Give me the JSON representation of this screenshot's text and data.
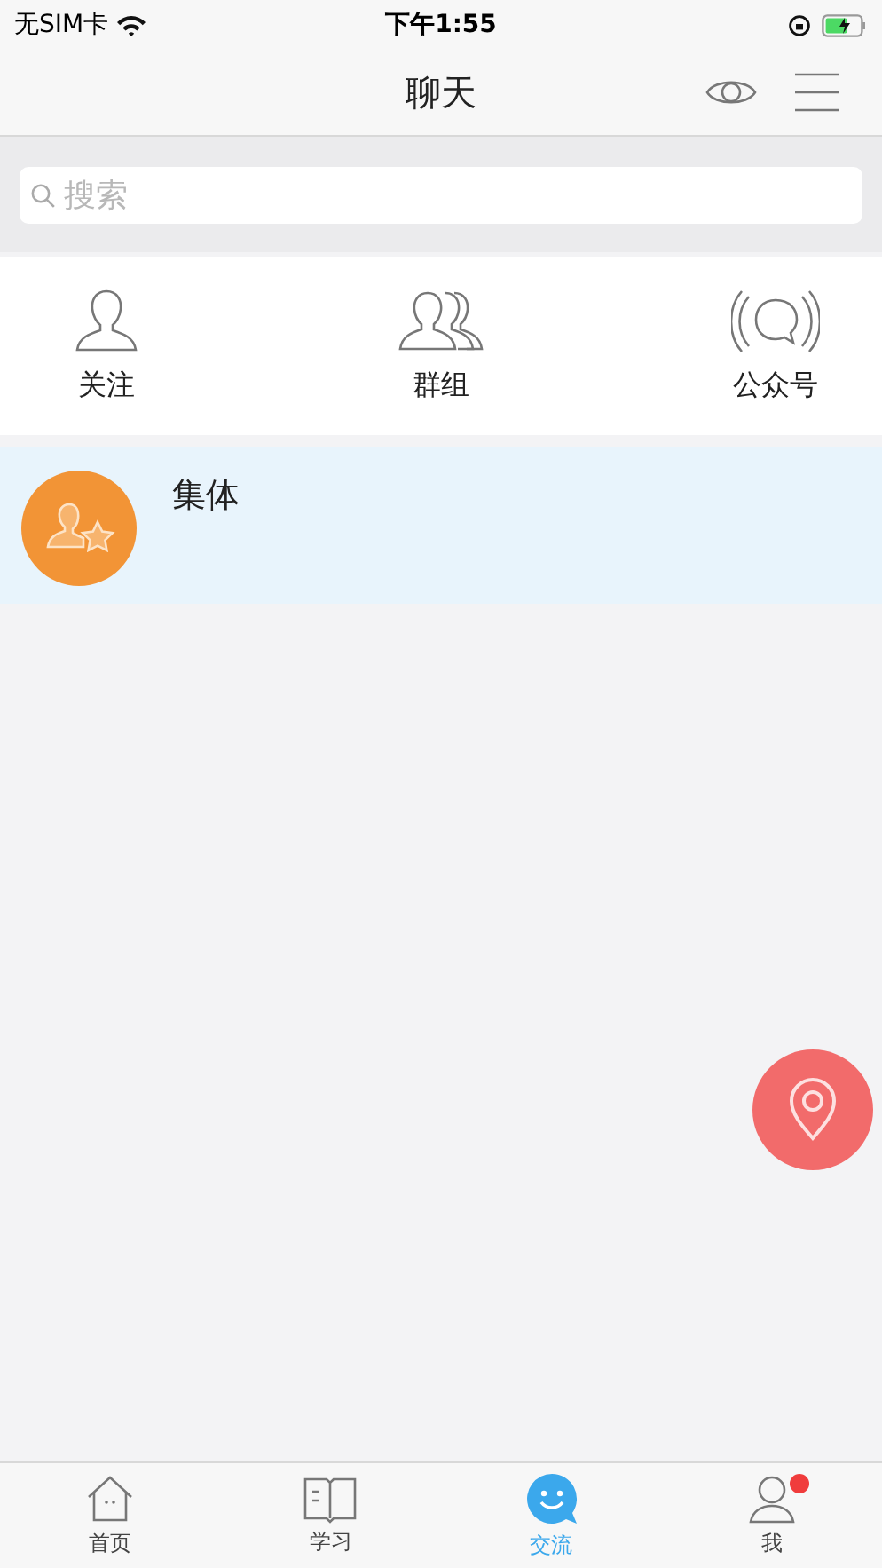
{
  "status_bar": {
    "carrier": "无SIM卡",
    "time": "下午1:55"
  },
  "nav": {
    "title": "聊天"
  },
  "search": {
    "placeholder": "搜索"
  },
  "shortcuts": [
    {
      "kind": "person",
      "label": "关注"
    },
    {
      "kind": "group",
      "label": "群组"
    },
    {
      "kind": "broadcast",
      "label": "公众号"
    }
  ],
  "conversations": [
    {
      "name": "集体",
      "selected": true
    }
  ],
  "tabs": [
    {
      "kind": "home",
      "label": "首页",
      "selected": false,
      "badge": false
    },
    {
      "kind": "book",
      "label": "学习",
      "selected": false,
      "badge": false
    },
    {
      "kind": "chat",
      "label": "交流",
      "selected": true,
      "badge": false
    },
    {
      "kind": "me",
      "label": "我",
      "selected": false,
      "badge": true
    }
  ]
}
